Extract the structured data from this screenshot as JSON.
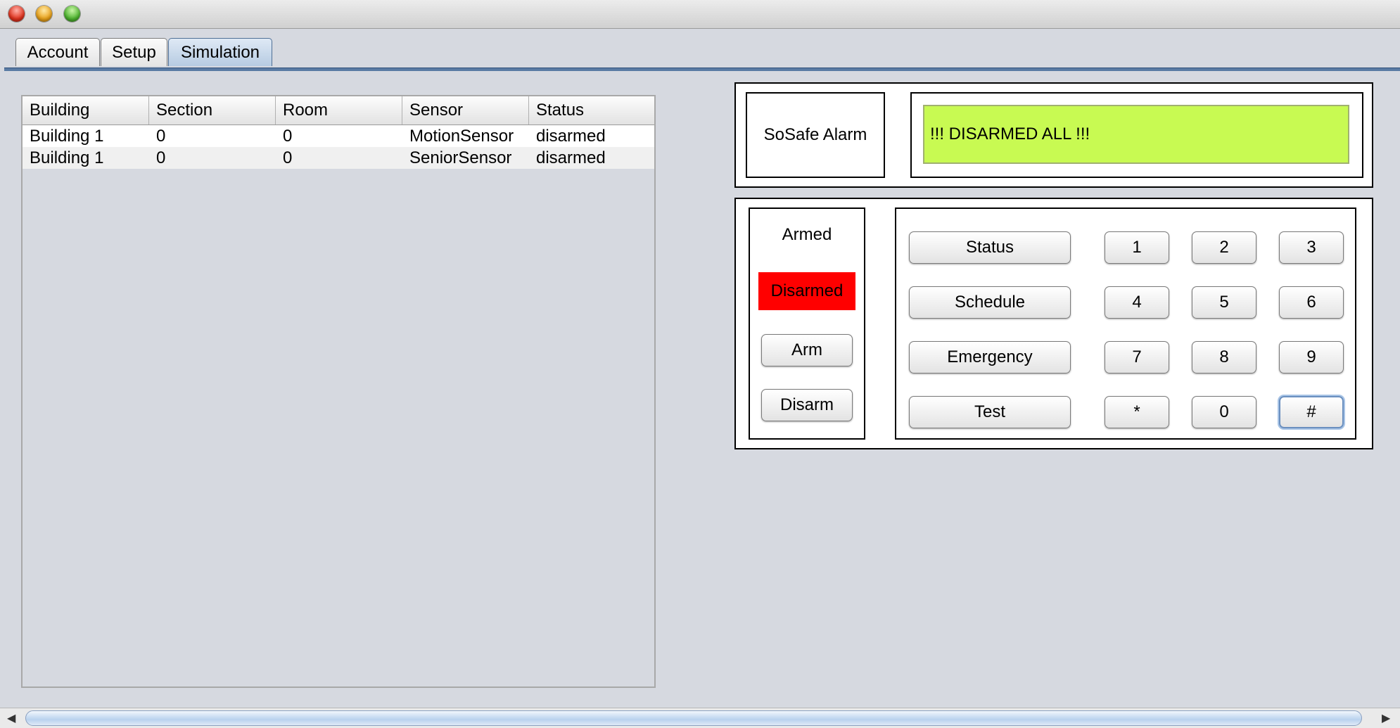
{
  "tabs": [
    {
      "label": "Account"
    },
    {
      "label": "Setup"
    },
    {
      "label": "Simulation"
    }
  ],
  "active_tab": "Simulation",
  "table": {
    "columns": [
      "Building",
      "Section",
      "Room",
      "Sensor",
      "Status"
    ],
    "rows": [
      [
        "Building 1",
        "0",
        "0",
        "MotionSensor",
        "disarmed"
      ],
      [
        "Building 1",
        "0",
        "0",
        "SeniorSensor",
        "disarmed"
      ]
    ]
  },
  "alarm": {
    "brand": "SoSafe Alarm",
    "display_text": "!!! DISARMED ALL !!!",
    "display_color": "#c8fa52",
    "state_armed_label": "Armed",
    "state_disarmed_label": "Disarmed",
    "active_state_color": "#ff0000",
    "arm_button": "Arm",
    "disarm_button": "Disarm",
    "function_buttons": [
      "Status",
      "Schedule",
      "Emergency",
      "Test"
    ],
    "keys": [
      [
        "1",
        "2",
        "3"
      ],
      [
        "4",
        "5",
        "6"
      ],
      [
        "7",
        "8",
        "9"
      ],
      [
        "*",
        "0",
        "#"
      ]
    ]
  },
  "scrollbar": {
    "left_arrow": "◀",
    "right_arrow": "▶"
  }
}
